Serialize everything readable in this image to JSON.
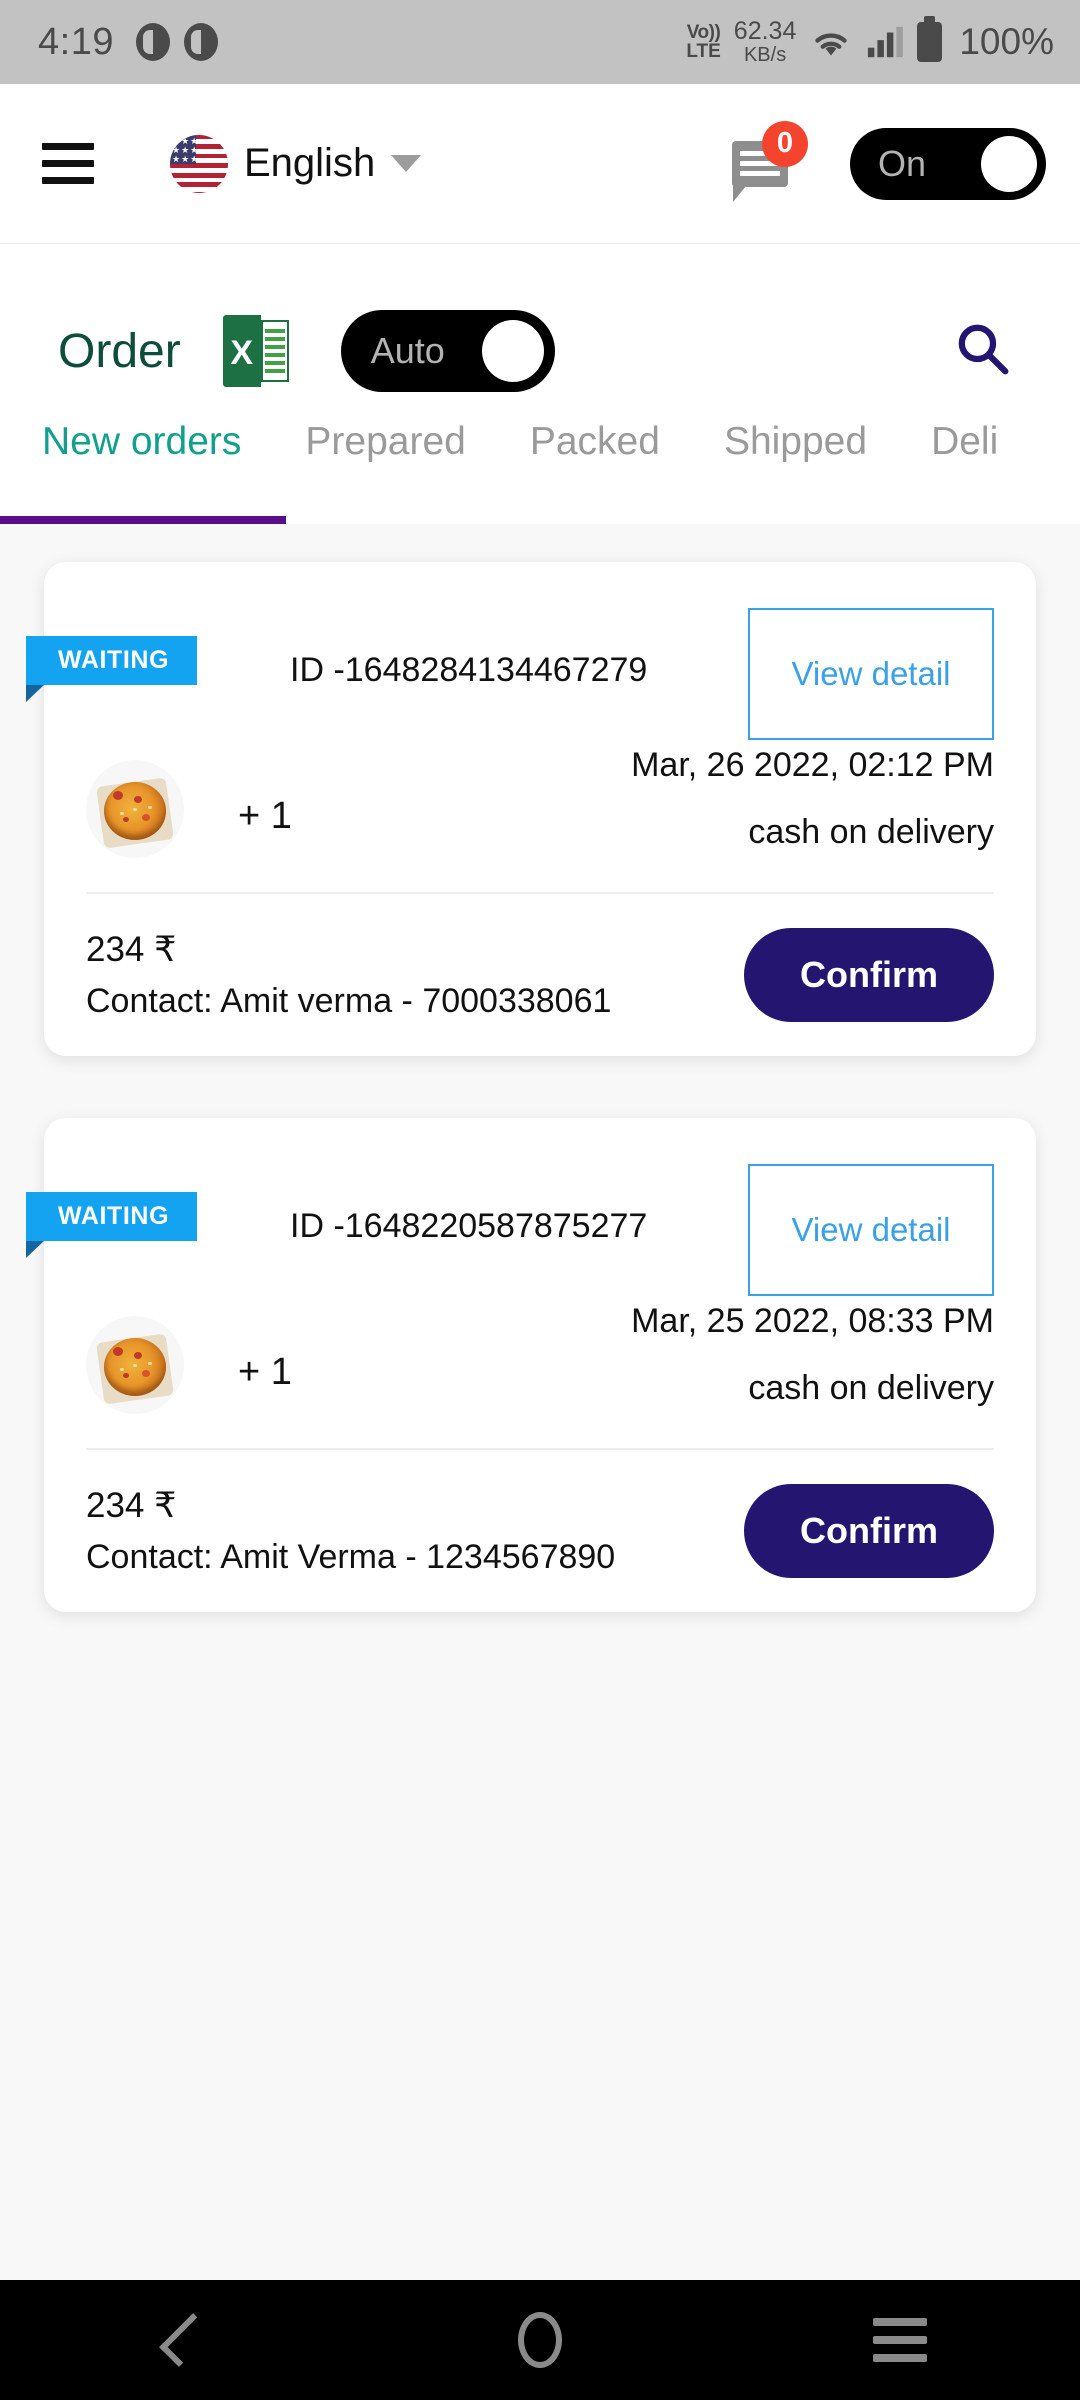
{
  "status_bar": {
    "time": "4:19",
    "network_type": "VoLTE",
    "volte_line1": "Vo))",
    "volte_line2": "LTE",
    "net_speed_value": "62.34",
    "net_speed_unit": "KB/s",
    "battery_percent": "100%",
    "icons": [
      "do-not-disturb-icon",
      "do-not-disturb-icon",
      "wifi-icon",
      "signal-icon",
      "battery-icon"
    ]
  },
  "header": {
    "menu_icon": "hamburger-menu-icon",
    "language": "English",
    "flag": "us-flag-icon",
    "dropdown_icon": "chevron-down-icon",
    "chat_icon": "chat-message-icon",
    "chat_badge_count": "0",
    "status_toggle_label": "On",
    "status_toggle_on": true
  },
  "order_bar": {
    "title": "Order",
    "export_icon": "excel-export-icon",
    "export_icon_letter": "X",
    "auto_toggle_label": "Auto",
    "auto_toggle_on": true,
    "search_icon": "search-icon"
  },
  "tabs": {
    "active_index": 0,
    "items": [
      {
        "label": "New orders"
      },
      {
        "label": "Prepared"
      },
      {
        "label": "Packed"
      },
      {
        "label": "Shipped"
      },
      {
        "label": "Deli"
      }
    ]
  },
  "orders": [
    {
      "status": "WAITING",
      "id_label": "ID -1648284134467279",
      "view_detail_label": "View detail",
      "date": "Mar, 26 2022, 02:12 PM",
      "payment": "cash on delivery",
      "item_thumb": "pizza-thumbnail",
      "quantity": "+ 1",
      "price": "234 ₹",
      "contact": "Contact: Amit verma - 7000338061",
      "confirm_label": "Confirm"
    },
    {
      "status": "WAITING",
      "id_label": "ID -1648220587875277",
      "view_detail_label": "View detail",
      "date": "Mar, 25 2022, 08:33 PM",
      "payment": "cash on delivery",
      "item_thumb": "pizza-thumbnail",
      "quantity": "+ 1",
      "price": "234 ₹",
      "contact": "Contact: Amit Verma - 1234567890",
      "confirm_label": "Confirm"
    }
  ],
  "nav_bar": {
    "back_icon": "back-chevron-icon",
    "home_icon": "home-circle-icon",
    "recents_icon": "recents-menu-icon"
  },
  "colors": {
    "status_bar_bg": "#c2c2c2",
    "order_title": "#0e4c3c",
    "tab_active": "#12a08c",
    "tab_underline": "#5b0e8b",
    "ribbon": "#13a3f0",
    "view_detail_border": "#3aa0e8",
    "confirm_bg": "#241570",
    "badge_bg": "#f4442e",
    "excel_green": "#1d7044",
    "search_icon": "#241570"
  }
}
